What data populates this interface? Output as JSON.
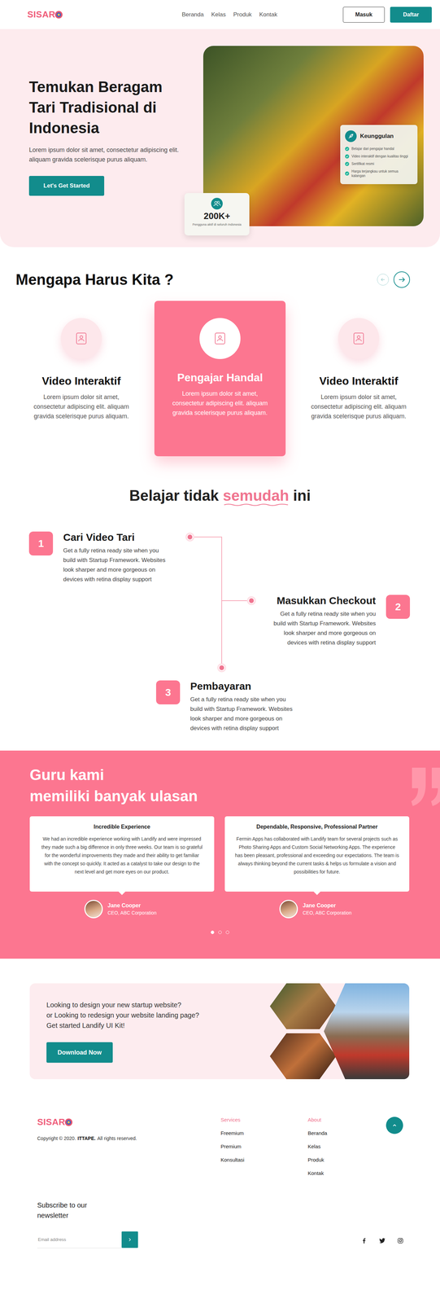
{
  "nav": {
    "logo": "SISAR",
    "links": [
      "Beranda",
      "Kelas",
      "Produk",
      "Kontak"
    ],
    "login": "Masuk",
    "register": "Daftar"
  },
  "hero": {
    "title": "Temukan Beragam Tari Tradisional di Indonesia",
    "text": "Lorem ipsum dolor sit amet, consectetur adipiscing elit. aliquam gravida scelerisque purus aliquam.",
    "cta": "Let's Get Started",
    "stat": {
      "value": "200K+",
      "caption": "Pengguna aktif di seluruh Indonesia"
    },
    "features": {
      "title": "Keunggulan",
      "items": [
        "Belajar dari pengajar handal",
        "Video interaktif dengan kualitas tinggi",
        "Sertifikat resmi",
        "Harga terjangkau untuk semua kalangan"
      ]
    }
  },
  "why": {
    "title": "Mengapa Harus Kita ?",
    "arrows": {
      "prev_disabled": true,
      "next_disabled": false
    },
    "cards": [
      {
        "title": "Video Interaktif",
        "text": "Lorem ipsum dolor sit amet, consectetur adipiscing elit. aliquam gravida scelerisque purus aliquam.",
        "selected": false
      },
      {
        "title": "Pengajar Handal",
        "text": "Lorem ipsum dolor sit amet, consectetur adipiscing elit. aliquam gravida scelerisque purus aliquam.",
        "selected": true
      },
      {
        "title": "Video Interaktif",
        "text": "Lorem ipsum dolor sit amet, consectetur adipiscing elit. aliquam gravida scelerisque purus aliquam.",
        "selected": false
      }
    ]
  },
  "steps": {
    "title": [
      {
        "text": "Belajar tidak",
        "highlight": false
      },
      {
        "text": "semudah",
        "highlight": true
      },
      {
        "text": "ini",
        "highlight": false
      }
    ],
    "items": [
      {
        "number": "1",
        "title": "Cari Video Tari",
        "text": "Get a fully retina ready site when you build with Startup Framework. Websites look sharper and more gorgeous on devices with retina display support"
      },
      {
        "number": "2",
        "title": "Masukkan Checkout",
        "text": "Get a fully retina ready site when you build with Startup Framework. Websites look sharper and more gorgeous on devices with retina display support"
      },
      {
        "number": "3",
        "title": "Pembayaran",
        "text": "Get a fully retina ready site when you build with Startup Framework. Websites look sharper and more gorgeous on devices with retina display support"
      }
    ]
  },
  "reviews": {
    "title_lines": [
      "Guru kami",
      "memiliki banyak ulasan"
    ],
    "items": [
      {
        "title": "Incredible Experience",
        "text": "We had an incredible experience working with Landify and were impressed they made such a big difference in only three weeks. Our team is so grateful for the wonderful improvements they made and their ability to get familiar with the concept so quickly. It acted as a catalyst to take our design to the next level and get more eyes on our product.",
        "name": "Jane Cooper",
        "role": "CEO, ABC Corporation"
      },
      {
        "title": "Dependable, Responsive, Professional Partner",
        "text": "Fermin Apps has collaborated with Landify team for several projects such as Photo Sharing Apps and Custom Social Networking Apps. The experience has been pleasant, professional and exceeding our expectations. The team is always thinking beyond the current tasks & helps us formulate a vision and possibilities for future.",
        "name": "Jane Cooper",
        "role": "CEO, ABC Corporation"
      }
    ],
    "pages": [
      {
        "selected": true
      },
      {
        "selected": false
      },
      {
        "selected": false
      }
    ]
  },
  "cta": {
    "lines": [
      "Looking to design your new startup website?",
      "or Looking to redesign your website landing page?",
      "Get started Landify UI Kit!"
    ],
    "button": "Download Now"
  },
  "footer": {
    "logo": "SISAR",
    "copyright": "Copyright © 2020.",
    "company": "ITTAPE.",
    "rights": "All rights reserved.",
    "columns": [
      {
        "title": "Services",
        "items": [
          "Freemium",
          "Premium",
          "Konsultasi"
        ]
      },
      {
        "title": "About",
        "items": [
          "Beranda",
          "Kelas",
          "Produk",
          "Kontak"
        ]
      }
    ],
    "newsletter": {
      "title": "Subscribe to our newsletter",
      "placeholder": "Email address"
    }
  }
}
